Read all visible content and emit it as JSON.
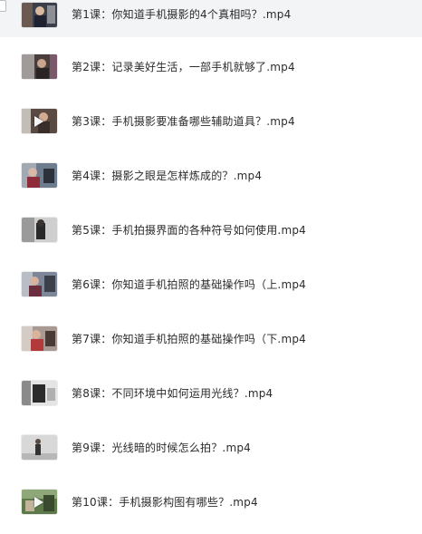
{
  "files": [
    {
      "name": "第1课：你知道手机摄影的4个真相吗？.mp4",
      "icon": "video-thumbnail-icon"
    },
    {
      "name": "第2课：记录美好生活，一部手机就够了.mp4",
      "icon": "video-thumbnail-icon"
    },
    {
      "name": "第3课：手机摄影要准备哪些辅助道具？.mp4",
      "icon": "video-thumbnail-icon"
    },
    {
      "name": "第4课：摄影之眼是怎样炼成的？.mp4",
      "icon": "video-thumbnail-icon"
    },
    {
      "name": "第5课：手机拍摄界面的各种符号如何使用.mp4",
      "icon": "video-thumbnail-icon"
    },
    {
      "name": "第6课：你知道手机拍照的基础操作吗（上.mp4",
      "icon": "video-thumbnail-icon"
    },
    {
      "name": "第7课：你知道手机拍照的基础操作吗（下.mp4",
      "icon": "video-thumbnail-icon"
    },
    {
      "name": "第8课：不同环境中如何运用光线？.mp4",
      "icon": "video-thumbnail-icon"
    },
    {
      "name": "第9课：光线暗的时候怎么拍？.mp4",
      "icon": "video-thumbnail-icon"
    },
    {
      "name": "第10课：手机摄影构图有哪些？.mp4",
      "icon": "video-thumbnail-icon"
    }
  ],
  "selected_index": 0,
  "colors": {
    "selected_row_bg": "#f2f4f6",
    "text": "#2b2b2b"
  }
}
